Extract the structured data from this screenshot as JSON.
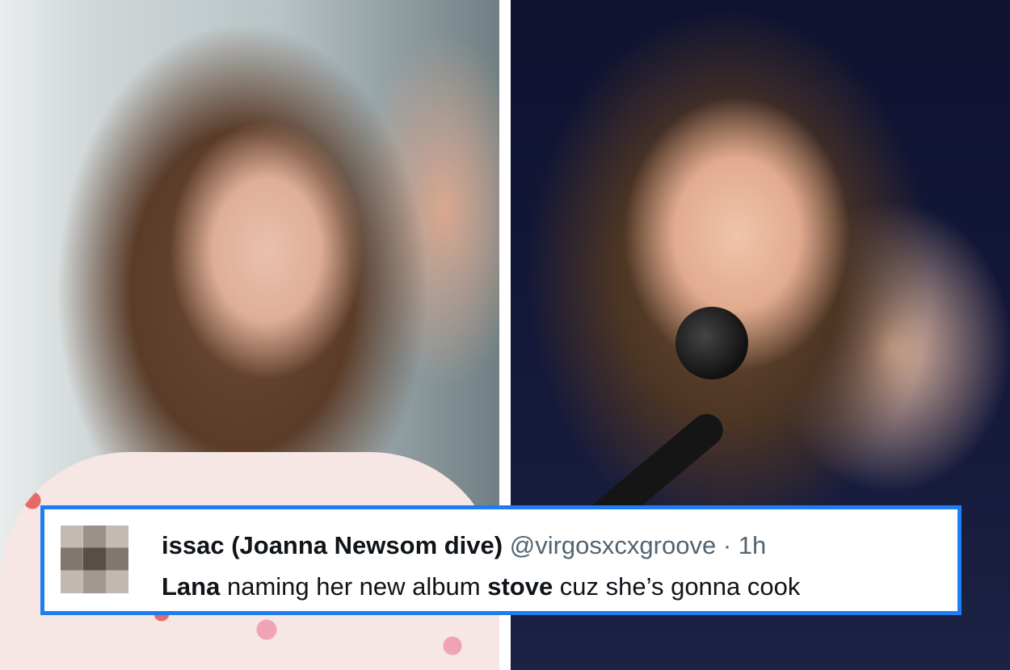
{
  "tweet": {
    "display_name": "issac (Joanna Newsom dive)",
    "handle": "@virgosxcxgroove",
    "separator": "·",
    "timestamp": "1h",
    "text_parts": {
      "a": "Lana",
      "b": " naming her new album ",
      "c": "stove",
      "d": " cuz she’s gonna cook"
    }
  },
  "colors": {
    "tweet_border": "#1d7ef2",
    "name": "#0f1419",
    "meta": "#536471"
  }
}
